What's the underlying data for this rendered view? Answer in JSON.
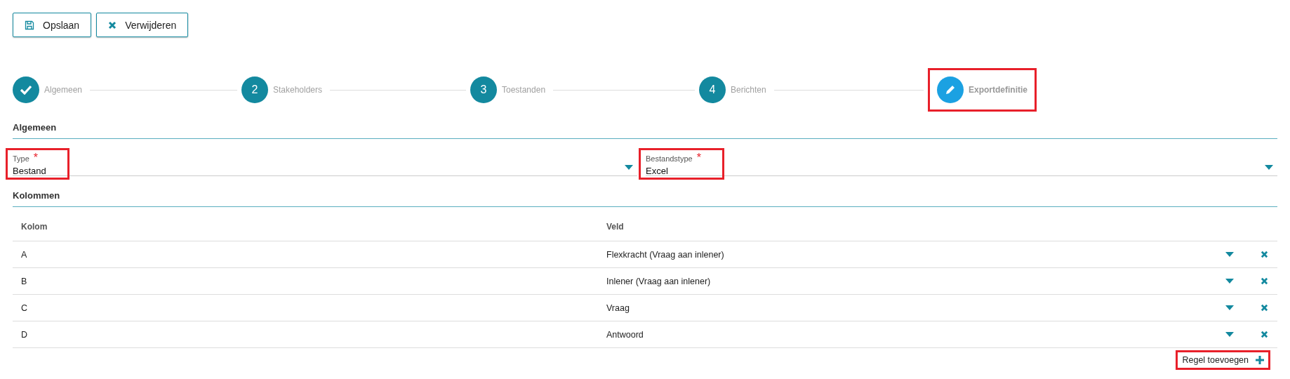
{
  "toolbar": [
    {
      "kind": "save",
      "label": "Opslaan"
    },
    {
      "kind": "delete",
      "label": "Verwijderen"
    }
  ],
  "steps": [
    {
      "label": "Algemeen",
      "done": true,
      "current": false,
      "highlighted": false
    },
    {
      "label": "Stakeholders",
      "number": "2",
      "done": false,
      "current": false,
      "highlighted": false
    },
    {
      "label": "Toestanden",
      "number": "3",
      "done": false,
      "current": false,
      "highlighted": false
    },
    {
      "label": "Berichten",
      "number": "4",
      "done": false,
      "current": false,
      "highlighted": false
    },
    {
      "label": "Exportdefinitie",
      "done": false,
      "current": true,
      "highlighted": true
    }
  ],
  "general": {
    "title": "Algemeen",
    "fields": [
      {
        "label": "Type",
        "required_mark": "*",
        "value": "Bestand",
        "highlighted": true
      },
      {
        "label": "Bestandstype",
        "required_mark": "*",
        "value": "Excel",
        "highlighted": true
      }
    ]
  },
  "columns_section": {
    "title": "Kolommen",
    "table": {
      "columns": [
        "Kolom",
        "Veld"
      ],
      "rows": [
        {
          "kolom": "A",
          "veld": "Flexkracht (Vraag aan inlener)"
        },
        {
          "kolom": "B",
          "veld": "Inlener (Vraag aan inlener)"
        },
        {
          "kolom": "C",
          "veld": "Vraag"
        },
        {
          "kolom": "D",
          "veld": "Antwoord"
        }
      ]
    },
    "add_button": {
      "label": "Regel toevoegen",
      "highlighted": true
    }
  }
}
